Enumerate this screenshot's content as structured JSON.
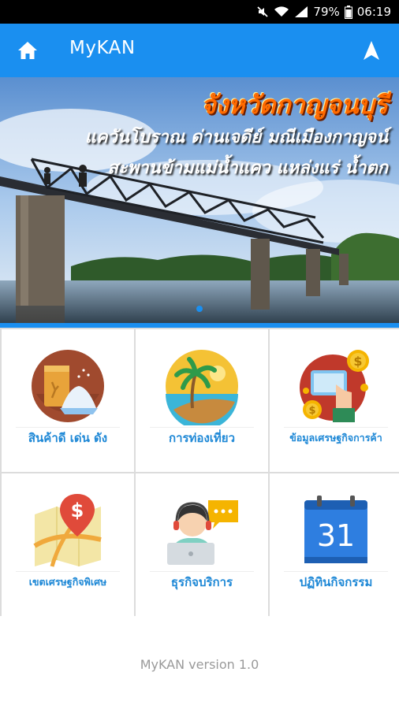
{
  "status": {
    "battery": "79%",
    "time": "06:19"
  },
  "appbar": {
    "title": "MyKAN"
  },
  "banner": {
    "title": "จังหวัดกาญจนบุรี",
    "line1": "แควันโบราณ ด่านเจดีย์ มณีเมืองกาญจน์",
    "line2": "สะพานข้ามแม่น้ำแคว แหล่งแร่ น้ำตก",
    "slide_count": 1,
    "active_slide": 0
  },
  "menu": [
    {
      "label": "สินค้าดี เด่น ดัง",
      "icon": "rice-sack-icon"
    },
    {
      "label": "การท่องเที่ยว",
      "icon": "beach-palm-icon"
    },
    {
      "label": "ข้อมูลเศรษฐกิจการค้า",
      "icon": "mobile-payment-icon"
    },
    {
      "label": "เขตเศรษฐกิจพิเศษ",
      "icon": "map-pin-dollar-icon"
    },
    {
      "label": "ธุรกิจบริการ",
      "icon": "call-center-icon"
    },
    {
      "label": "ปฏิทินกิจกรรม",
      "icon": "calendar-icon",
      "day": "31"
    }
  ],
  "footer": {
    "version": "MyKAN version 1.0"
  }
}
